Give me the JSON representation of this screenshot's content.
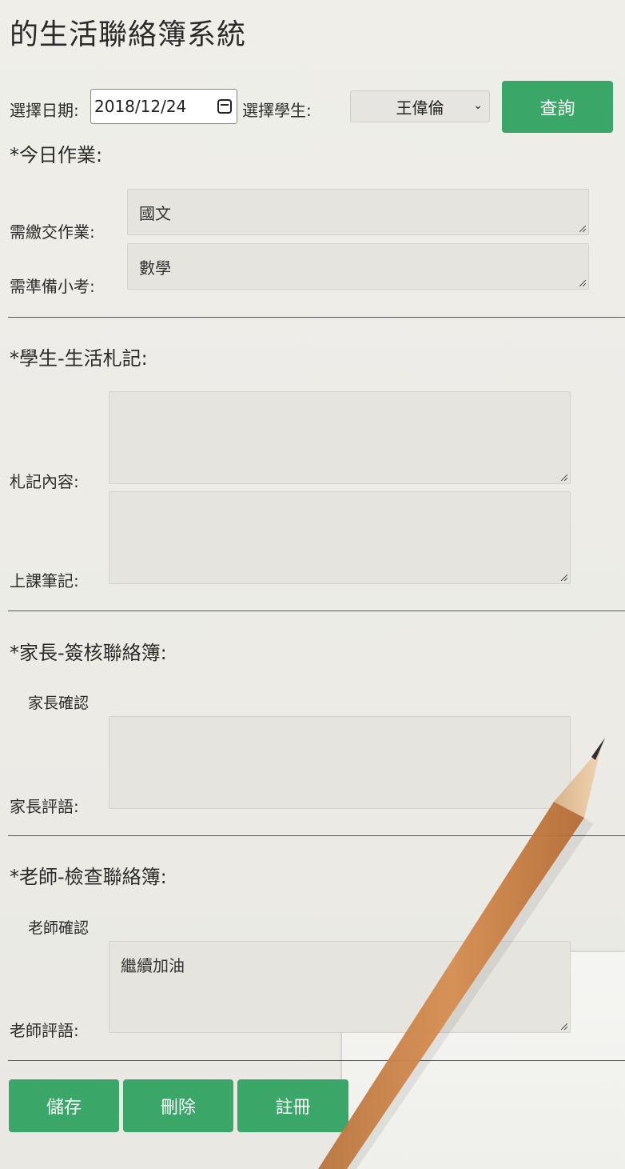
{
  "page": {
    "title": "的生活聯絡簿系統"
  },
  "query": {
    "date_label": "選擇日期:",
    "date_value": "2018/12/24",
    "student_label": "選擇學生:",
    "student_selected": "王偉倫",
    "query_button": "查詢"
  },
  "homework": {
    "heading": "*今日作業:",
    "submit_label": "需繳交作業:",
    "submit_value": "國文",
    "quiz_label": "需準備小考:",
    "quiz_value": "數學"
  },
  "student_notes": {
    "heading": "*學生-生活札記:",
    "notes_label": "札記內容:",
    "notes_value": "",
    "class_notes_label": "上課筆記:",
    "class_notes_value": ""
  },
  "parent": {
    "heading": "*家長-簽核聯絡簿:",
    "confirm_label": "家長確認",
    "comment_label": "家長評語:",
    "comment_value": ""
  },
  "teacher": {
    "heading": "*老師-檢查聯絡簿:",
    "confirm_label": "老師確認",
    "comment_label": "老師評語:",
    "comment_value": "繼續加油"
  },
  "actions": {
    "save": "儲存",
    "delete": "刪除",
    "register": "註冊"
  },
  "colors": {
    "accent": "#3aa768",
    "background": "#edece7"
  }
}
